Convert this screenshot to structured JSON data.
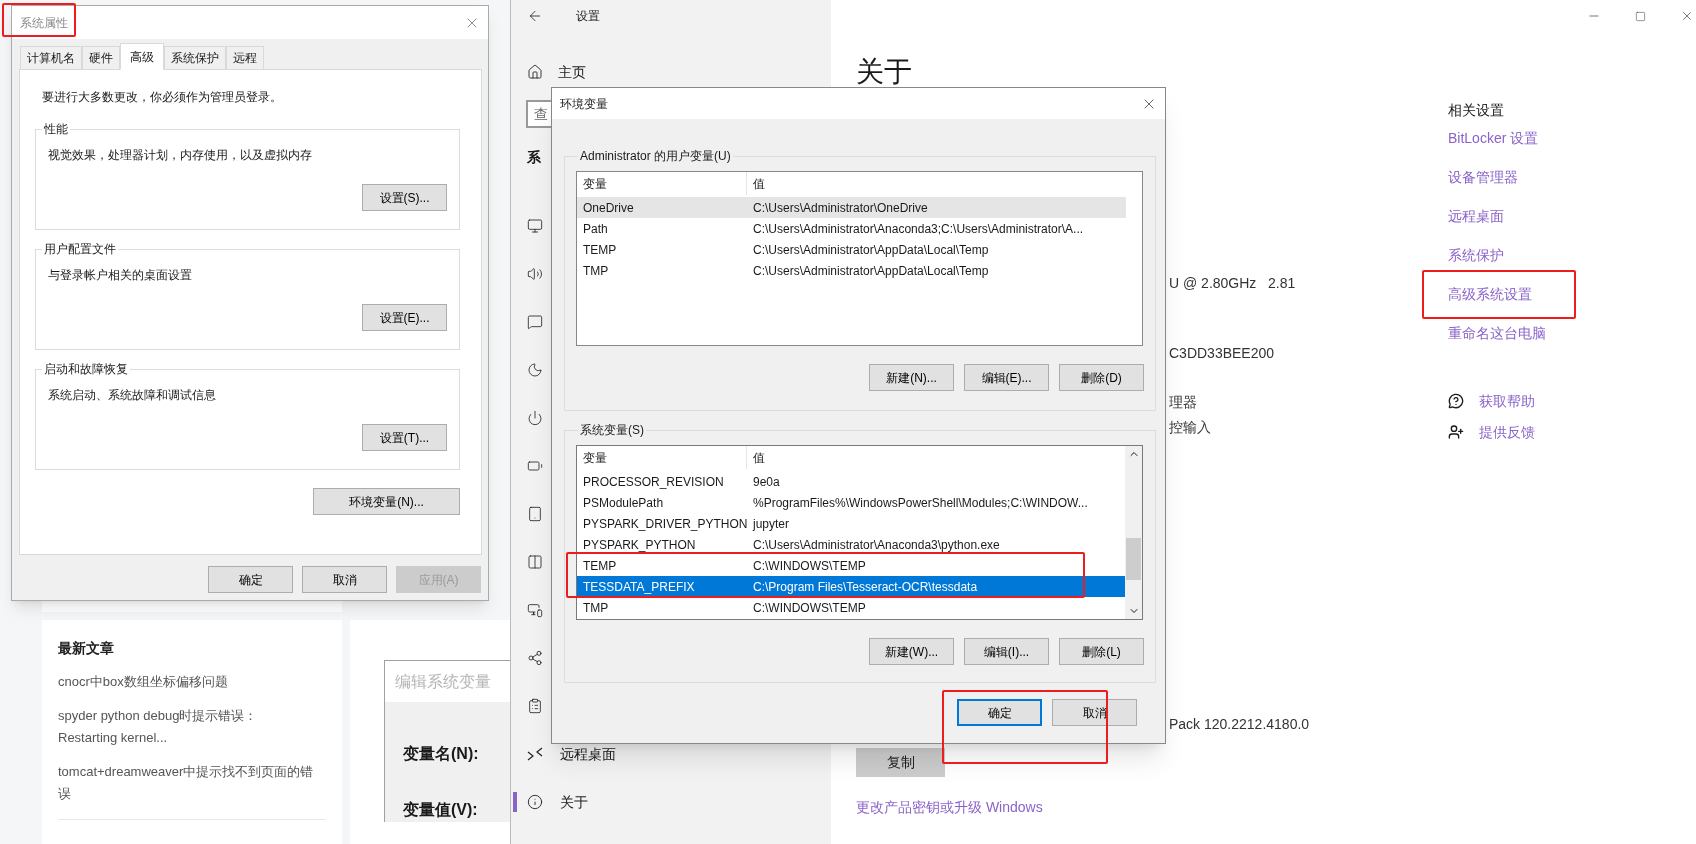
{
  "blog": {
    "heading": "最新文章",
    "articles": [
      {
        "lines": [
          "cnocr中box数组坐标偏移问题"
        ]
      },
      {
        "lines": [
          "spyder python debug时提示错误：",
          "Restarting kernel..."
        ]
      },
      {
        "lines": [
          "tomcat+dreamweaver中提示找不到页面的错",
          "误"
        ]
      }
    ]
  },
  "edit_dialog": {
    "title": "编辑系统变量",
    "labels": [
      "变量名(N):",
      "变量值(V):"
    ]
  },
  "settings": {
    "title": "设置",
    "nav": {
      "home": "主页",
      "search_placeholder": "查",
      "section": "系",
      "items": [
        {
          "label": "远程桌面",
          "selected": false
        },
        {
          "label": "关于",
          "selected": true
        }
      ]
    },
    "heading": "关于",
    "peek_texts": [
      "U @ 2.80GHz   2.81",
      "C3DD33BEE200",
      "理器",
      "控输入",
      "Pack 120.2212.4180.0"
    ],
    "copy_button": "复制",
    "product_link": "更改产品密钥或升级 Windows",
    "related": {
      "heading": "相关设置",
      "links": [
        "BitLocker 设置",
        "设备管理器",
        "远程桌面",
        "系统保护",
        "高级系统设置",
        "重命名这台电脑"
      ],
      "support": [
        "获取帮助",
        "提供反馈"
      ]
    }
  },
  "sysprops": {
    "title": "系统属性",
    "tabs": [
      {
        "label": "计算机名",
        "selected": false
      },
      {
        "label": "硬件",
        "selected": false
      },
      {
        "label": "高级",
        "selected": true
      },
      {
        "label": "系统保护",
        "selected": false
      },
      {
        "label": "远程",
        "selected": false
      }
    ],
    "notice": "要进行大多数更改，你必须作为管理员登录。",
    "groups": [
      {
        "legend": "性能",
        "text": "视觉效果，处理器计划，内存使用，以及虚拟内存",
        "button": "设置(S)..."
      },
      {
        "legend": "用户配置文件",
        "text": "与登录帐户相关的桌面设置",
        "button": "设置(E)..."
      },
      {
        "legend": "启动和故障恢复",
        "text": "系统启动、系统故障和调试信息",
        "button": "设置(T)..."
      }
    ],
    "env_button": "环境变量(N)...",
    "buttons": [
      {
        "label": "确定",
        "disabled": false
      },
      {
        "label": "取消",
        "disabled": false
      },
      {
        "label": "应用(A)",
        "disabled": true
      }
    ]
  },
  "envvars": {
    "title": "环境变量",
    "user_vars": {
      "legend": "Administrator 的用户变量(U)",
      "focused": false,
      "columns": [
        "变量",
        "值"
      ],
      "rows": [
        {
          "name": "OneDrive",
          "value": "C:\\Users\\Administrator\\OneDrive",
          "selected": true
        },
        {
          "name": "Path",
          "value": "C:\\Users\\Administrator\\Anaconda3;C:\\Users\\Administrator\\A...",
          "selected": false
        },
        {
          "name": "TEMP",
          "value": "C:\\Users\\Administrator\\AppData\\Local\\Temp",
          "selected": false
        },
        {
          "name": "TMP",
          "value": "C:\\Users\\Administrator\\AppData\\Local\\Temp",
          "selected": false
        }
      ],
      "buttons": [
        "新建(N)...",
        "编辑(E)...",
        "删除(D)"
      ]
    },
    "system_vars": {
      "legend": "系统变量(S)",
      "focused": true,
      "columns": [
        "变量",
        "值"
      ],
      "rows": [
        {
          "name": "PROCESSOR_REVISION",
          "value": "9e0a",
          "selected": false
        },
        {
          "name": "PSModulePath",
          "value": "%ProgramFiles%\\WindowsPowerShell\\Modules;C:\\WINDOW...",
          "selected": false
        },
        {
          "name": "PYSPARK_DRIVER_PYTHON",
          "value": "jupyter",
          "selected": false
        },
        {
          "name": "PYSPARK_PYTHON",
          "value": "C:\\Users\\Administrator\\Anaconda3\\python.exe",
          "selected": false
        },
        {
          "name": "TEMP",
          "value": "C:\\WINDOWS\\TEMP",
          "selected": false
        },
        {
          "name": "TESSDATA_PREFIX",
          "value": "C:\\Program Files\\Tesseract-OCR\\tessdata",
          "selected": true
        },
        {
          "name": "TMP",
          "value": "C:\\WINDOWS\\TEMP",
          "selected": false
        }
      ],
      "buttons": [
        "新建(W)...",
        "编辑(I)...",
        "删除(L)"
      ]
    },
    "buttons": [
      {
        "label": "确定",
        "default": true
      },
      {
        "label": "取消",
        "default": false
      }
    ]
  }
}
